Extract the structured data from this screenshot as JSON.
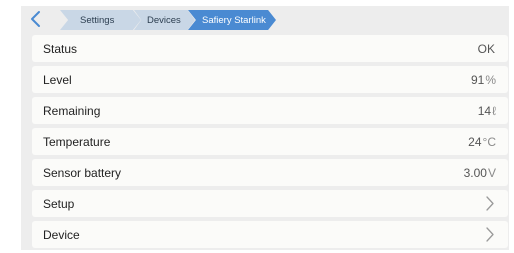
{
  "breadcrumb": {
    "items": [
      "Settings",
      "Devices",
      "Safiery Starlink"
    ]
  },
  "rows": [
    {
      "label": "Status",
      "value": "OK",
      "unit": ""
    },
    {
      "label": "Level",
      "value": "91",
      "unit": "%"
    },
    {
      "label": "Remaining",
      "value": "14",
      "unit": "ℓ"
    },
    {
      "label": "Temperature",
      "value": "24",
      "unit": "°C"
    },
    {
      "label": "Sensor battery",
      "value": "3.00",
      "unit": "V"
    },
    {
      "label": "Setup"
    },
    {
      "label": "Device"
    }
  ],
  "colors": {
    "accent": "#4a8ad2",
    "crumb": "#c9d7e6",
    "panel": "#ededed",
    "row": "#fbfbf9"
  },
  "icons": {
    "back": "chevron-left-icon",
    "row_arrow": "chevron-right-icon"
  }
}
